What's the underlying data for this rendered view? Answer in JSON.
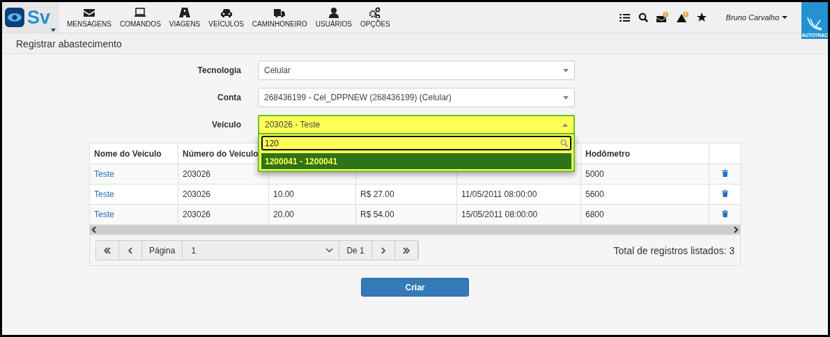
{
  "header": {
    "logo_text": "Sv",
    "nav": [
      {
        "label": "MENSAGENS"
      },
      {
        "label": "COMANDOS"
      },
      {
        "label": "VIAGENS"
      },
      {
        "label": "VEÍCULOS"
      },
      {
        "label": "CAMINHONEIRO"
      },
      {
        "label": "USUÁRIOS"
      },
      {
        "label": "OPÇÕES"
      }
    ],
    "user": "Bruno Carvalho",
    "brand": "AUTOTRAC"
  },
  "page_title": "Registrar abastecimento",
  "form": [
    {
      "label": "Tecnologia",
      "value": "Celular",
      "open": false
    },
    {
      "label": "Conta",
      "value": "268436199 - Cel_DPPNEW (268436199) (Celular)",
      "open": false
    },
    {
      "label": "Veículo",
      "value": "203026 - Teste",
      "open": true
    }
  ],
  "dropdown": {
    "search": "120",
    "options": [
      {
        "label": "1200041 - 1200041",
        "selected": true
      }
    ]
  },
  "table": {
    "columns": [
      "Nome do Veículo",
      "Número do Veículo",
      "",
      "",
      "",
      "Hodômetro",
      ""
    ],
    "rows": [
      [
        "Teste",
        "203026",
        null,
        null,
        null,
        "5000"
      ],
      [
        "Teste",
        "203026",
        "10.00",
        "R$ 27.00",
        "11/05/2011 08:00:00",
        "5600"
      ],
      [
        "Teste",
        "203026",
        "20.00",
        "R$ 54.00",
        "15/05/2011 08:00:00",
        "6800"
      ]
    ]
  },
  "pager": {
    "page_label": "Página",
    "page": "1",
    "of": "De 1",
    "total": "Total de registros listados: 3"
  },
  "create_button": "Criar"
}
